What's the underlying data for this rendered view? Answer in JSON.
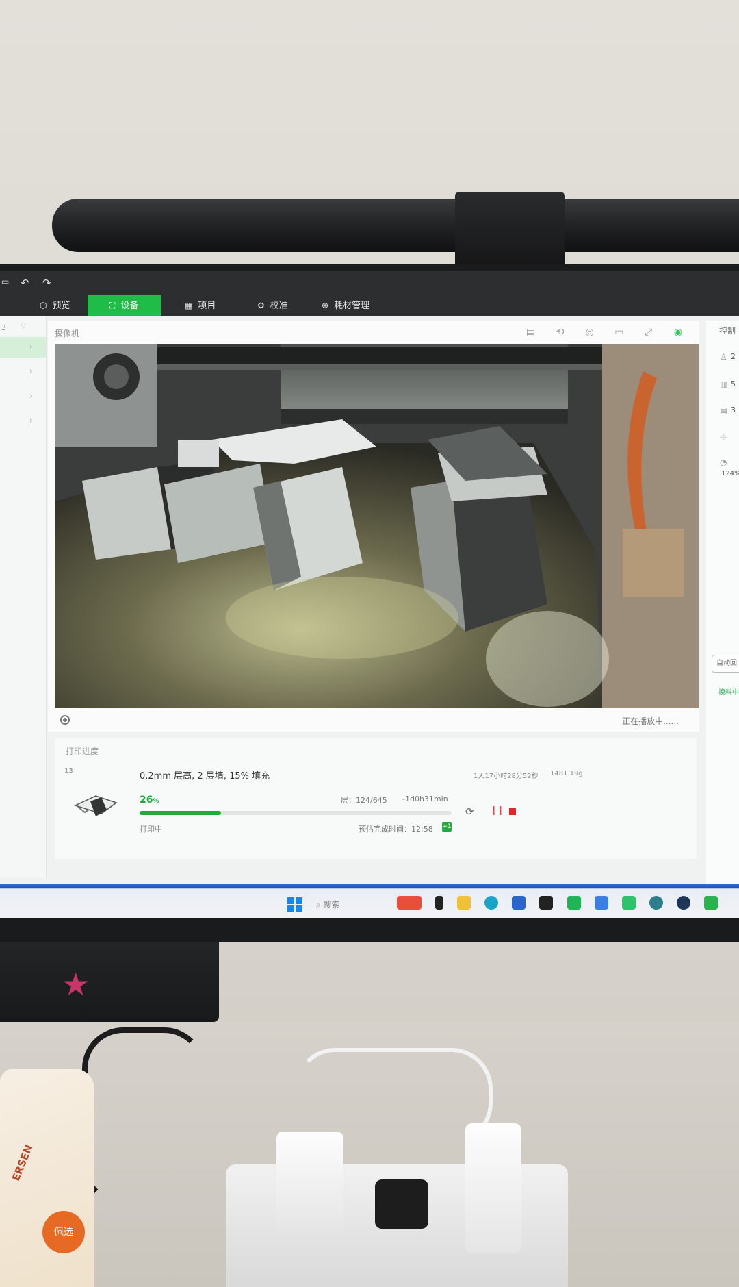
{
  "titlebar": {
    "undo_icon": "undo-icon",
    "redo_icon": "redo-icon"
  },
  "nav": {
    "tabs": [
      {
        "label": "预览",
        "icon": "cube-icon",
        "active": false
      },
      {
        "label": "设备",
        "icon": "device-icon",
        "active": true
      },
      {
        "label": "项目",
        "icon": "grid-icon",
        "active": false
      },
      {
        "label": "校准",
        "icon": "gear-icon",
        "active": false
      },
      {
        "label": "耗材管理",
        "icon": "spool-icon",
        "active": false
      }
    ]
  },
  "sidebar": {
    "top_label": "3"
  },
  "camera": {
    "title": "摄像机",
    "status": "正在播放中......",
    "tools": [
      "sd-card-icon",
      "camera-switch-icon",
      "webcam-icon",
      "record-icon",
      "fullscreen-icon",
      "live-dot-icon"
    ]
  },
  "control": {
    "title": "控制",
    "temps": [
      "2",
      "5",
      "3"
    ],
    "speed": "124%",
    "auto_label": "自动回",
    "swap_label": "换料中"
  },
  "progress": {
    "heading": "打印进度",
    "plate_number": "13",
    "spec": "0.2mm 层高, 2 层墙, 15% 填充",
    "elapsed": "1天17小时28分52秒",
    "weight": "1481.19g",
    "percent_value": "26",
    "percent_unit": "%",
    "percent": 26,
    "layers": "层：124/645",
    "remaining": "-1d0h31min",
    "state": "打印中",
    "eta": "预估完成时间：12:58",
    "eta_badge": "+1"
  },
  "taskbar": {
    "search": "搜索"
  },
  "desk": {
    "snack_brand": "ERSEN",
    "snack_badge": "佩选"
  },
  "colors": {
    "accent": "#1fbd48",
    "progress_fill": "#1fae3e",
    "stop": "#e02828"
  }
}
